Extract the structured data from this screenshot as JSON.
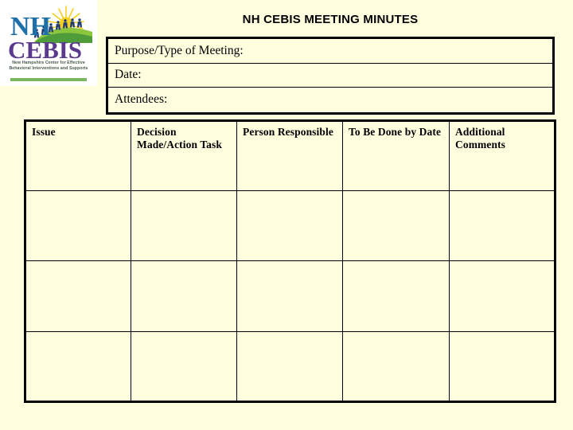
{
  "slide": {
    "title": "NH CEBIS MEETING MINUTES",
    "background_color": "#FFFFE0"
  },
  "logo": {
    "name": "nh-cebis-logo",
    "primary_text": "NH",
    "secondary_text": "CEBIS",
    "primary_color": "#1F6FA8",
    "secondary_color": "#5B3A8E",
    "accent_green": "#7BB661",
    "accent_yellow": "#F5D020",
    "tagline_line1": "New Hampshire Center for Effective",
    "tagline_line2": "Behavioral Interventions and Supports"
  },
  "meeting_info": {
    "rows": [
      {
        "label": "Purpose/Type of Meeting:",
        "value": ""
      },
      {
        "label": "Date:",
        "value": ""
      },
      {
        "label": "Attendees:",
        "value": ""
      }
    ]
  },
  "minutes_table": {
    "headers": [
      "Issue",
      "Decision Made/Action Task",
      "Person Responsible",
      "To Be Done by Date",
      "Additional Comments"
    ],
    "rows": [
      {
        "issue": "",
        "decision": "",
        "person": "",
        "date": "",
        "comments": ""
      },
      {
        "issue": "",
        "decision": "",
        "person": "",
        "date": "",
        "comments": ""
      },
      {
        "issue": "",
        "decision": "",
        "person": "",
        "date": "",
        "comments": ""
      }
    ]
  }
}
